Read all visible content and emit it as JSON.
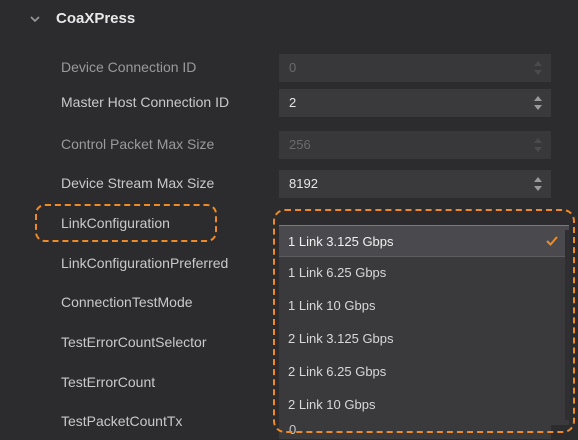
{
  "section": {
    "title": "CoaXPress",
    "icon": "chevron-down-icon"
  },
  "rows": [
    {
      "label": "Device Connection ID",
      "value": "0",
      "state": "disabled"
    },
    {
      "label": "Master Host Connection ID",
      "value": "2",
      "state": "enabled"
    },
    {
      "label": "Control Packet Max Size",
      "value": "256",
      "state": "disabled"
    },
    {
      "label": "Device Stream Max Size",
      "value": "8192",
      "state": "enabled"
    },
    {
      "label": "LinkConfiguration",
      "value": "1 Link 3.125 Gbps",
      "state": "dropdown-open"
    },
    {
      "label": "LinkConfigurationPreferred"
    },
    {
      "label": "ConnectionTestMode"
    },
    {
      "label": "TestErrorCountSelector"
    },
    {
      "label": "TestErrorCount"
    },
    {
      "label": "TestPacketCountTx",
      "value": "0"
    }
  ],
  "dropdown": {
    "options": [
      "1 Link 3.125 Gbps",
      "1 Link 6.25 Gbps",
      "1 Link 10 Gbps",
      "2 Link 3.125 Gbps",
      "2 Link 6.25 Gbps",
      "2 Link 10 Gbps"
    ],
    "selected": "1 Link 3.125 Gbps"
  },
  "colors": {
    "highlight": "#f08a24",
    "check": "#f08a24",
    "background": "#2c2c2e"
  }
}
